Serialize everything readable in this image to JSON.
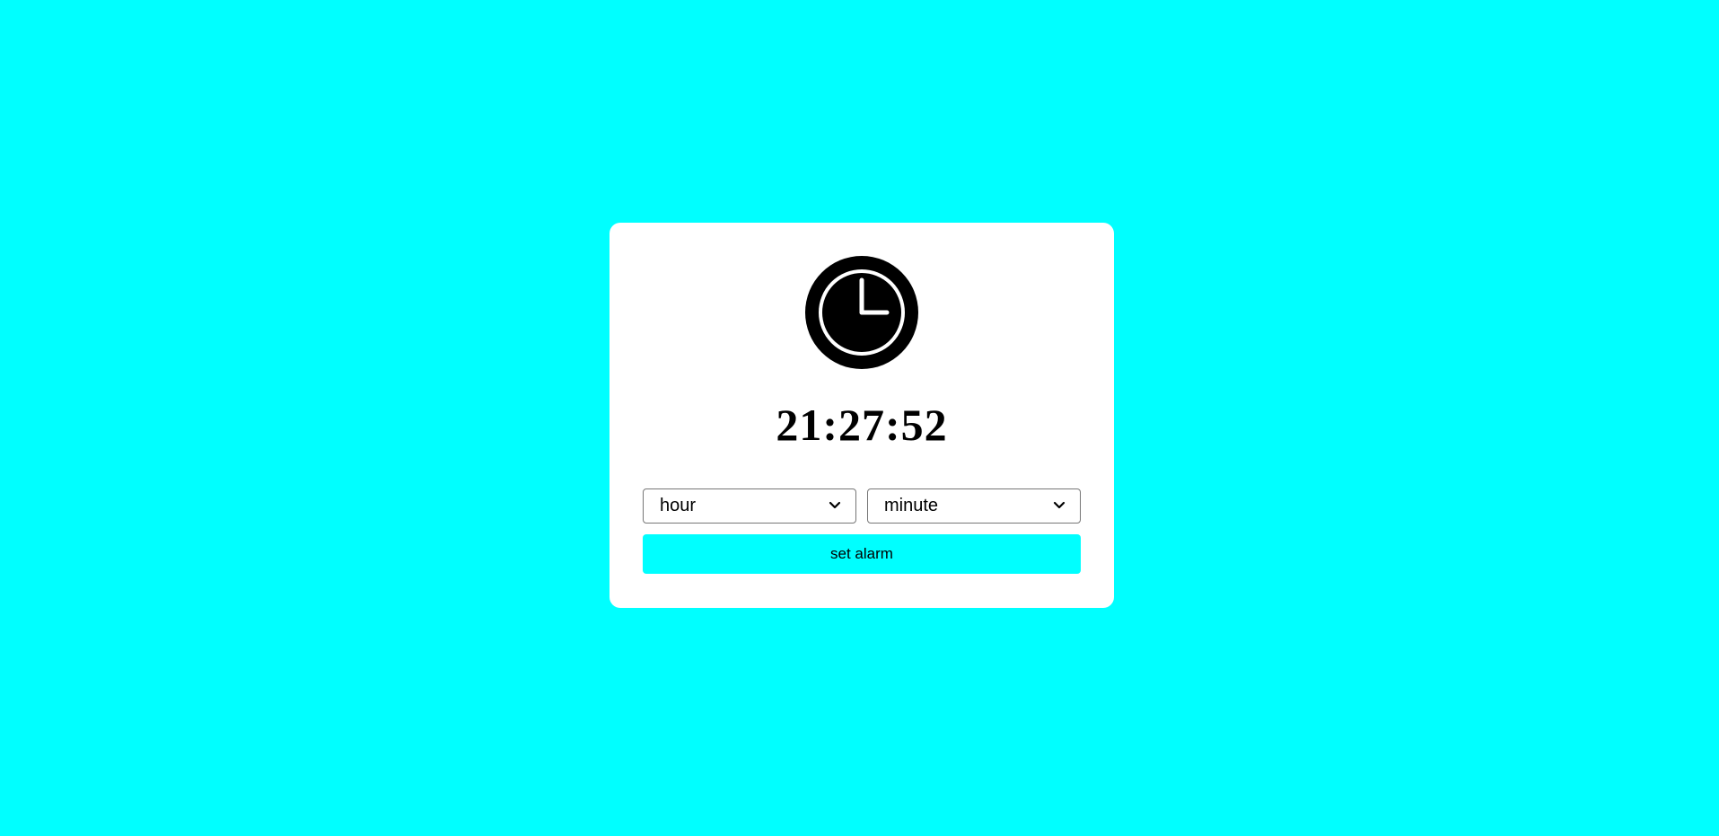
{
  "colors": {
    "background": "#00FFFF",
    "card": "#FFFFFF",
    "button": "#00FFFF",
    "text": "#000000"
  },
  "clock": {
    "icon": "clock-icon",
    "time": "21:27:52"
  },
  "alarm": {
    "hour_select": {
      "selected": "hour",
      "icon": "chevron-down-icon"
    },
    "minute_select": {
      "selected": "minute",
      "icon": "chevron-down-icon"
    },
    "set_label": "set alarm"
  }
}
